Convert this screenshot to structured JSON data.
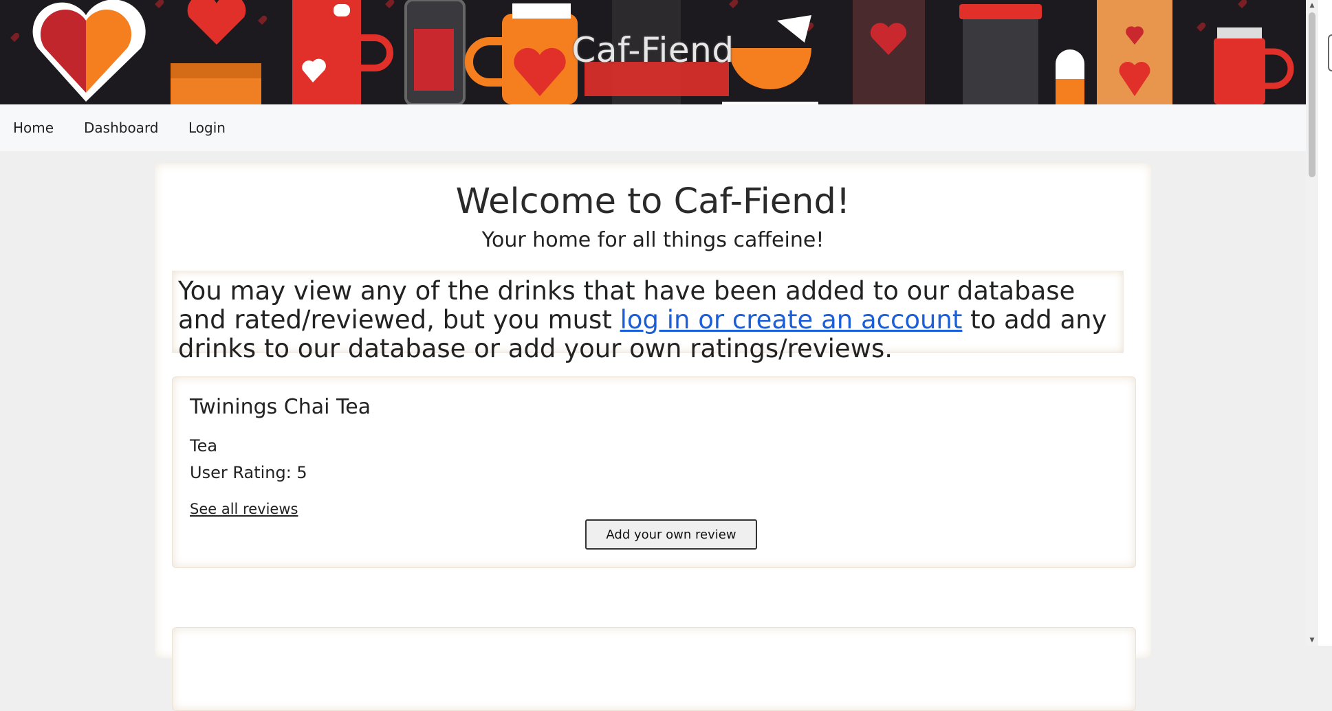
{
  "site": {
    "title": "Caf-Fiend"
  },
  "nav": {
    "items": [
      {
        "label": "Home"
      },
      {
        "label": "Dashboard"
      },
      {
        "label": "Login"
      }
    ]
  },
  "welcome": {
    "title": "Welcome to Caf-Fiend!",
    "subtitle": "Your home for all things caffeine!"
  },
  "info": {
    "text_before": "You may view any of the drinks that have been added to our database and rated/reviewed, but you must ",
    "link_text": "log in or create an account",
    "text_after": " to add any drinks to our database or add your own ratings/reviews."
  },
  "drinks": [
    {
      "name": "Twinings Chai Tea",
      "type": "Tea",
      "rating_label": "User Rating: 5",
      "see_reviews_label": "See all reviews",
      "add_review_label": "Add your own review"
    }
  ],
  "colors": {
    "banner_bg": "#1c1a1e",
    "accent_red": "#e1302a",
    "accent_orange": "#f57e1f",
    "link_blue": "#1a5fd8"
  },
  "icons": [
    "heart-icon",
    "mug-icon",
    "cup-icon"
  ]
}
